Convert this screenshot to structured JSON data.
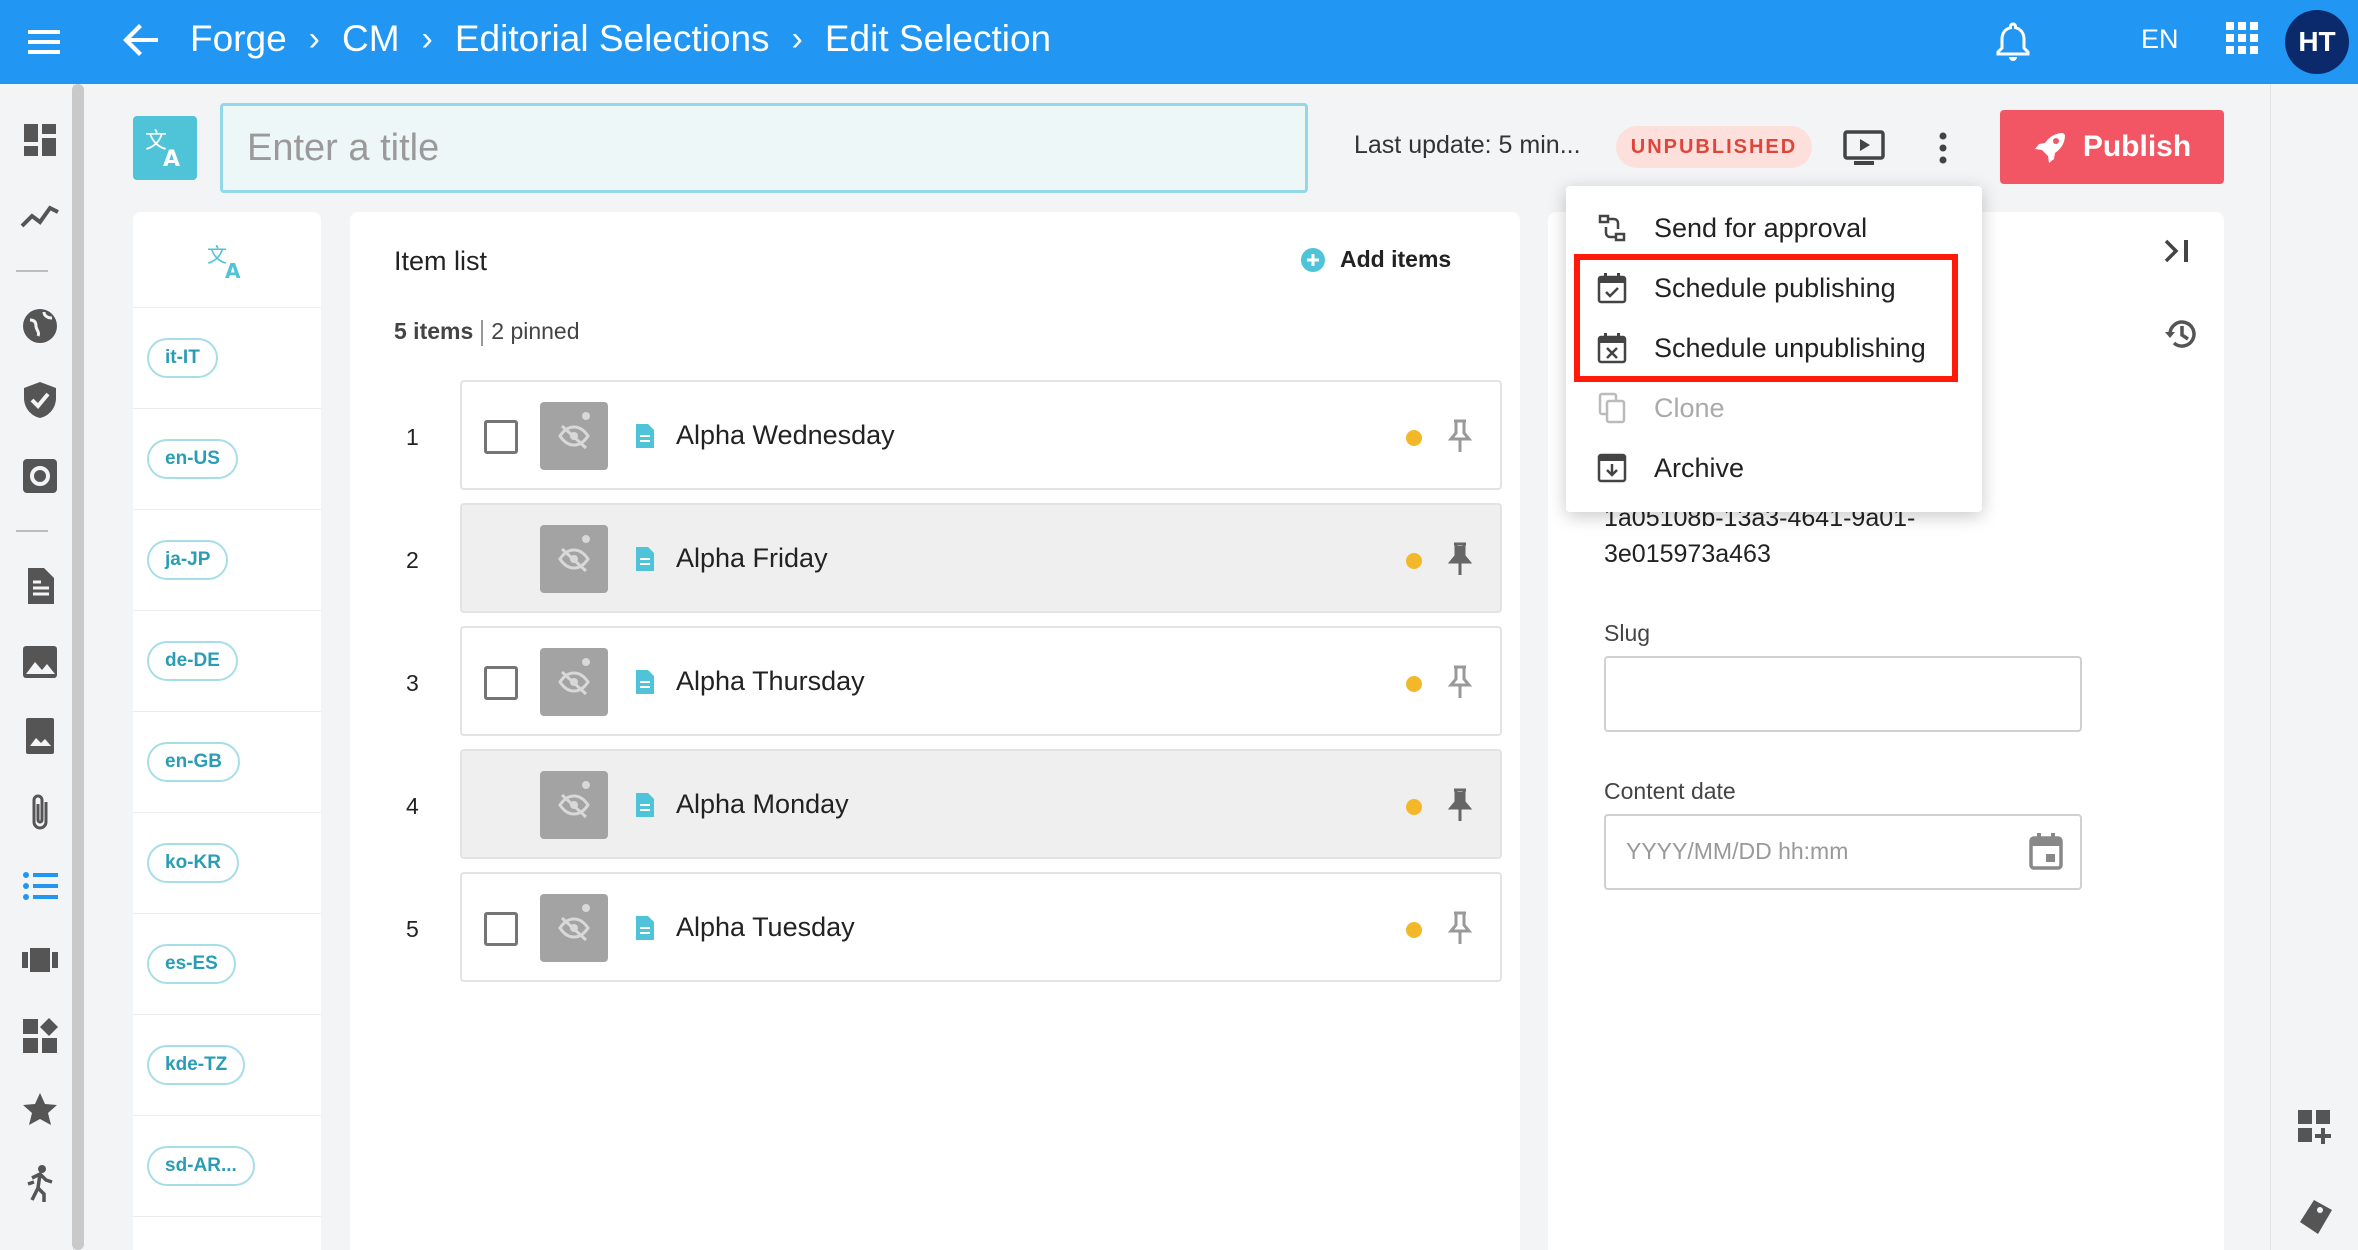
{
  "topbar": {
    "breadcrumbs": [
      "Forge",
      "CM",
      "Editorial Selections",
      "Edit Selection"
    ],
    "language": "EN",
    "avatar_initials": "HT"
  },
  "header": {
    "title_placeholder": "Enter a title",
    "last_update": "Last update: 5 min...",
    "status_badge": "UNPUBLISHED",
    "publish_label": "Publish"
  },
  "locales": [
    "it-IT",
    "en-US",
    "ja-JP",
    "de-DE",
    "en-GB",
    "ko-KR",
    "es-ES",
    "kde-TZ",
    "sd-AR..."
  ],
  "item_list": {
    "title": "Item list",
    "add_items": "Add items",
    "count_items": "5 items",
    "count_pinned": "2 pinned",
    "rows": [
      {
        "num": "1",
        "title": "Alpha Wednesday",
        "pinned": false
      },
      {
        "num": "2",
        "title": "Alpha Friday",
        "pinned": true
      },
      {
        "num": "3",
        "title": "Alpha Thursday",
        "pinned": false
      },
      {
        "num": "4",
        "title": "Alpha Monday",
        "pinned": true
      },
      {
        "num": "5",
        "title": "Alpha Tuesday",
        "pinned": false
      }
    ]
  },
  "details": {
    "uuid_line1": "1a05108b-13a3-4641-9a01-",
    "uuid_line2": "3e015973a463",
    "slug_label": "Slug",
    "content_date_label": "Content date",
    "content_date_placeholder": "YYYY/MM/DD hh:mm"
  },
  "menu": {
    "items": [
      {
        "label": "Send for approval",
        "icon": "approval-icon",
        "disabled": false
      },
      {
        "label": "Schedule publishing",
        "icon": "calendar-check-icon",
        "disabled": false
      },
      {
        "label": "Schedule unpublishing",
        "icon": "calendar-x-icon",
        "disabled": false
      },
      {
        "label": "Clone",
        "icon": "copy-icon",
        "disabled": true
      },
      {
        "label": "Archive",
        "icon": "archive-icon",
        "disabled": false
      }
    ]
  },
  "colors": {
    "primary": "#2196f3",
    "publish": "#f25563",
    "unpublished_bg": "#fde0dc",
    "unpublished_text": "#e0453a",
    "accent_teal": "#4fc3d8",
    "highlight": "#ff1a0a"
  }
}
